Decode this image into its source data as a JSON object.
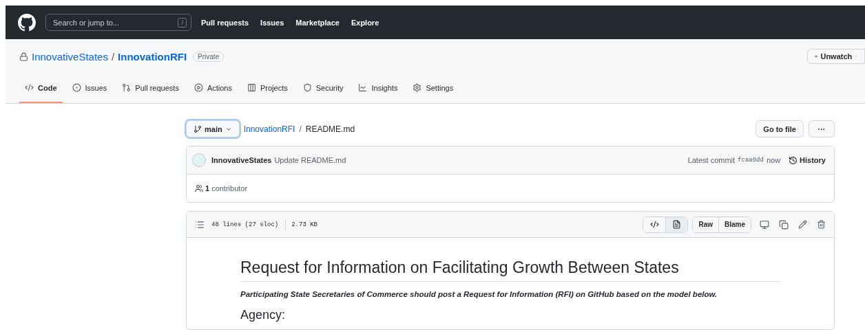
{
  "header": {
    "search": {
      "placeholder": "Search or jump to...",
      "shortcut": "/"
    },
    "nav": [
      "Pull requests",
      "Issues",
      "Marketplace",
      "Explore"
    ]
  },
  "repo": {
    "owner": "InnovativeStates",
    "separator": "/",
    "name": "InnovationRFI",
    "visibility": "Private",
    "watch_button": "Unwatch"
  },
  "tabs": [
    {
      "label": "Code",
      "selected": true
    },
    {
      "label": "Issues",
      "selected": false
    },
    {
      "label": "Pull requests",
      "selected": false
    },
    {
      "label": "Actions",
      "selected": false
    },
    {
      "label": "Projects",
      "selected": false
    },
    {
      "label": "Security",
      "selected": false
    },
    {
      "label": "Insights",
      "selected": false
    },
    {
      "label": "Settings",
      "selected": false
    }
  ],
  "file_nav": {
    "branch": "main",
    "path_repo": "InnovationRFI",
    "path_separator": "/",
    "path_file": "README.md",
    "go_to_file": "Go to file",
    "more": "···"
  },
  "commit": {
    "author": "InnovativeStates",
    "message": "Update README.md",
    "latest_label": "Latest commit",
    "sha": "fcaa9dd",
    "time": "now",
    "history": "History",
    "contributors": "1",
    "contributors_label": "contributor"
  },
  "file": {
    "lines": "48 lines (27 sloc)",
    "size": "2.73 KB",
    "view_modes": [
      {
        "kind": "code",
        "selected": false
      },
      {
        "kind": "preview",
        "selected": true
      }
    ],
    "buttons": [
      "Raw",
      "Blame"
    ]
  },
  "readme": {
    "title": "Request for Information on Facilitating Growth Between States",
    "intro": "Participating State Secretaries of Commerce should post a Request for Information (RFI) on GitHub based on the model below.",
    "section": "Agency:"
  }
}
